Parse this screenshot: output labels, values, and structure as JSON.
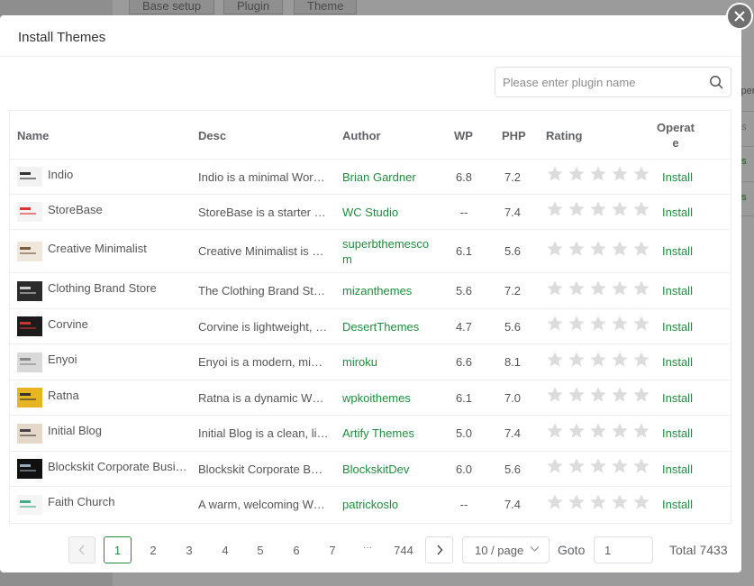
{
  "background": {
    "tabs": [
      "Base setup",
      "Plugin",
      "Theme"
    ],
    "right_col": [
      "Oper",
      "Ins",
      "Ins",
      "Ins"
    ]
  },
  "dialog": {
    "title": "Install Themes",
    "search_placeholder": "Please enter plugin name"
  },
  "table": {
    "headers": {
      "name": "Name",
      "desc": "Desc",
      "author": "Author",
      "wp": "WP",
      "php": "PHP",
      "rating": "Rating",
      "operate": "Operate"
    },
    "rows": [
      {
        "name": "Indio",
        "desc": "Indio is a minimal WordPress theme",
        "author": "Brian Gardner",
        "wp": "6.8",
        "php": "7.2",
        "rating": 0,
        "action": "Install"
      },
      {
        "name": "StoreBase",
        "desc": "StoreBase is a starter theme",
        "author": "WC Studio",
        "wp": "--",
        "php": "7.4",
        "rating": 0,
        "action": "Install"
      },
      {
        "name": "Creative Minimalist",
        "desc": "Creative Minimalist is a theme",
        "author": "superbthemescom",
        "wp": "6.1",
        "php": "5.6",
        "rating": 0,
        "action": "Install"
      },
      {
        "name": "Clothing Brand Store",
        "desc": "The Clothing Brand Store theme",
        "author": "mizanthemes",
        "wp": "5.6",
        "php": "7.2",
        "rating": 0,
        "action": "Install"
      },
      {
        "name": "Corvine",
        "desc": "Corvine is lightweight, responsive",
        "author": "DesertThemes",
        "wp": "4.7",
        "php": "5.6",
        "rating": 0,
        "action": "Install"
      },
      {
        "name": "Enyoi",
        "desc": "Enyoi is a modern, minimal theme",
        "author": "miroku",
        "wp": "6.6",
        "php": "8.1",
        "rating": 0,
        "action": "Install"
      },
      {
        "name": "Ratna",
        "desc": "Ratna is a dynamic WP theme",
        "author": "wpkoithemes",
        "wp": "6.1",
        "php": "7.0",
        "rating": 0,
        "action": "Install"
      },
      {
        "name": "Initial Blog",
        "desc": "Initial Blog is a clean, light theme",
        "author": "Artify Themes",
        "wp": "5.0",
        "php": "7.4",
        "rating": 0,
        "action": "Install"
      },
      {
        "name": "Blockskit Corporate Business",
        "desc": "Blockskit Corporate Business theme",
        "author": "BlockskitDev",
        "wp": "6.0",
        "php": "5.6",
        "rating": 0,
        "action": "Install"
      },
      {
        "name": "Faith Church",
        "desc": "A warm, welcoming WordPress theme",
        "author": "patrickoslo",
        "wp": "--",
        "php": "7.4",
        "rating": 0,
        "action": "Install"
      }
    ]
  },
  "pagination": {
    "pages": [
      "1",
      "2",
      "3",
      "4",
      "5",
      "6",
      "7",
      "···",
      "744"
    ],
    "current": "1",
    "page_size": "10 / page",
    "goto_label": "Goto",
    "goto_value": "1",
    "total": "Total 7433"
  },
  "colors": {
    "accent": "#1e8e3e",
    "star": "#dcdcdc",
    "border": "#ebeef5"
  }
}
